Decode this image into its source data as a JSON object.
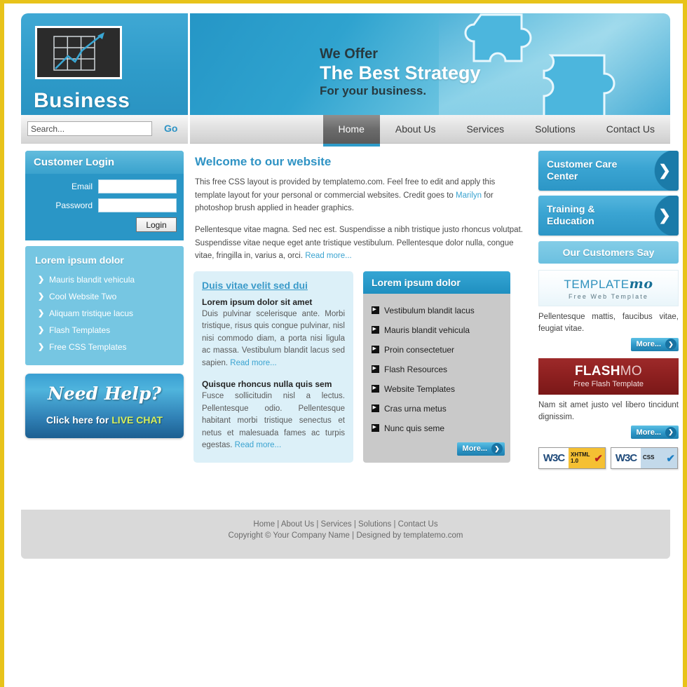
{
  "brand": {
    "name": "Business",
    "logo_icon": "line-chart-icon"
  },
  "banner": {
    "line1": "We Offer",
    "line2": "The Best Strategy",
    "line3": "For your business.",
    "graphic": "puzzle-pieces-graphic"
  },
  "search": {
    "value": "Search...",
    "placeholder": "Search...",
    "go_label": "Go",
    "icon": "search-icon"
  },
  "nav": {
    "items": [
      {
        "label": "Home",
        "active": true
      },
      {
        "label": "About Us",
        "active": false
      },
      {
        "label": "Services",
        "active": false
      },
      {
        "label": "Solutions",
        "active": false
      },
      {
        "label": "Contact Us",
        "active": false
      }
    ]
  },
  "login": {
    "title": "Customer Login",
    "email_label": "Email",
    "email_value": "",
    "password_label": "Password",
    "password_value": "",
    "submit_label": "Login"
  },
  "side_list": {
    "title": "Lorem ipsum dolor",
    "items": [
      "Mauris blandit vehicula",
      "Cool Website Two",
      "Aliquam tristique lacus",
      "Flash Templates",
      "Free CSS Templates"
    ]
  },
  "help_banner": {
    "line1": "Need Help?",
    "line2_prefix": "Click here for ",
    "line2_highlight": "LIVE CHAT"
  },
  "welcome": {
    "heading": "Welcome to our website",
    "p1_a": "This free CSS layout is provided by templatemo.com. Feel free to edit and apply this template layout for your personal or commercial websites. Credit goes to ",
    "p1_link": "Marilyn",
    "p1_b": " for photoshop brush applied in header graphics.",
    "p2_a": "Pellentesque vitae magna. Sed nec est. Suspendisse a nibh tristique justo rhoncus volutpat. Suspendisse vitae neque eget ante tristique vestibulum. Pellentesque dolor nulla, congue vitae, fringilla in, varius a, orci. ",
    "p2_link": "Read more..."
  },
  "box_left": {
    "heading": "Duis vitae velit sed dui",
    "sub1": "Lorem ipsum dolor sit amet",
    "text1": "Duis pulvinar scelerisque ante. Morbi tristique, risus quis congue pulvinar, nisl nisi commodo diam, a porta nisi ligula ac massa. Vestibulum blandit lacus sed sapien. ",
    "link1": "Read more...",
    "sub2": "Quisque rhoncus nulla quis sem",
    "text2": "Fusce sollicitudin nisl a lectus. Pellentesque odio. Pellentesque habitant morbi tristique senectus et netus et malesuada fames ac turpis egestas. ",
    "link2": "Read more..."
  },
  "box_right": {
    "heading": "Lorem ipsum dolor",
    "items": [
      "Vestibulum blandit lacus",
      "Mauris blandit vehicula",
      "Proin consectetuer",
      "Flash Resources",
      "Website Templates",
      "Cras urna metus",
      "Nunc quis seme"
    ],
    "more_label": "More..."
  },
  "cta": [
    {
      "title": "Customer Care Center",
      "icon": "chevron-right-icon"
    },
    {
      "title": "Training & Education",
      "icon": "chevron-right-icon"
    }
  ],
  "testimonials": {
    "title": "Our Customers Say"
  },
  "ads": [
    {
      "logo_main": "TEMPLATE",
      "logo_accent": "mo",
      "logo_sub": "Free Web Template",
      "text": "Pellentesque mattis, faucibus vitae, feugiat vitae.",
      "more_label": "More..."
    },
    {
      "logo_main": "FLASH",
      "logo_accent": "MO",
      "logo_sub": "Free Flash Template",
      "text": "Nam sit amet justo vel libero tincidunt dignissim.",
      "more_label": "More..."
    }
  ],
  "badges": [
    {
      "org": "W3C",
      "label_line1": "XHTML",
      "label_line2": "1.0",
      "check": "✔"
    },
    {
      "org": "W3C",
      "label_line1": "CSS",
      "label_line2": "",
      "check": "✔"
    }
  ],
  "footer": {
    "links": "Home | About Us | Services | Solutions | Contact Us",
    "copyright": "Copyright © Your Company Name | Designed by templatemo.com"
  },
  "colors": {
    "accent_blue": "#2e9bc9",
    "light_blue": "#76c6e2",
    "pale_blue": "#dcf0f8",
    "border_yellow": "#e8c31a",
    "gray_panel": "#c9c9c9",
    "footer_gray": "#d9d9d9",
    "flashmo_red": "#8e2020"
  }
}
